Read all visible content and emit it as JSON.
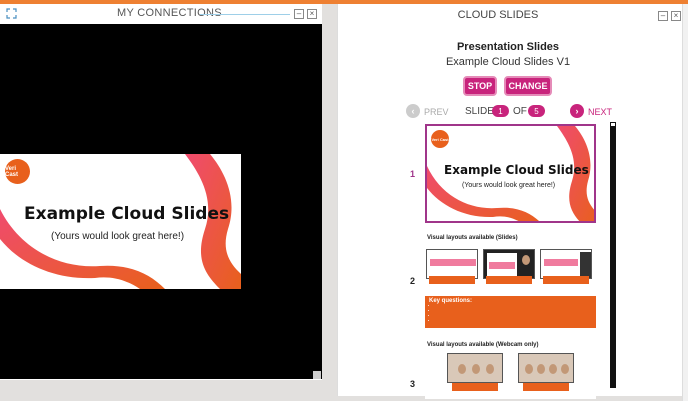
{
  "left_window": {
    "title": "MY CONNECTIONS"
  },
  "slide": {
    "logo": "Veri Cast",
    "title": "Example Cloud Slides",
    "subtitle": "(Yours would look great here!)"
  },
  "right_window": {
    "title": "CLOUD SLIDES",
    "heading": "Presentation Slides",
    "presentation_name": "Example Cloud Slides V1",
    "stop_label": "STOP",
    "change_label": "CHANGE",
    "nav": {
      "prev": "PREV",
      "slide_word": "SLIDE",
      "current": "1",
      "of_word": "OF",
      "total": "5",
      "next": "NEXT"
    },
    "slide_numbers": [
      "1",
      "2",
      "3"
    ],
    "thumb2": {
      "section_title": "Visual layouts available (Slides)",
      "key_questions_title": "Key questions:"
    },
    "thumb3": {
      "section_title": "Visual layouts available (Webcam only)"
    }
  },
  "colors": {
    "accent": "#c8247c",
    "orange": "#e8601c",
    "highlight_border": "#a0358a"
  }
}
